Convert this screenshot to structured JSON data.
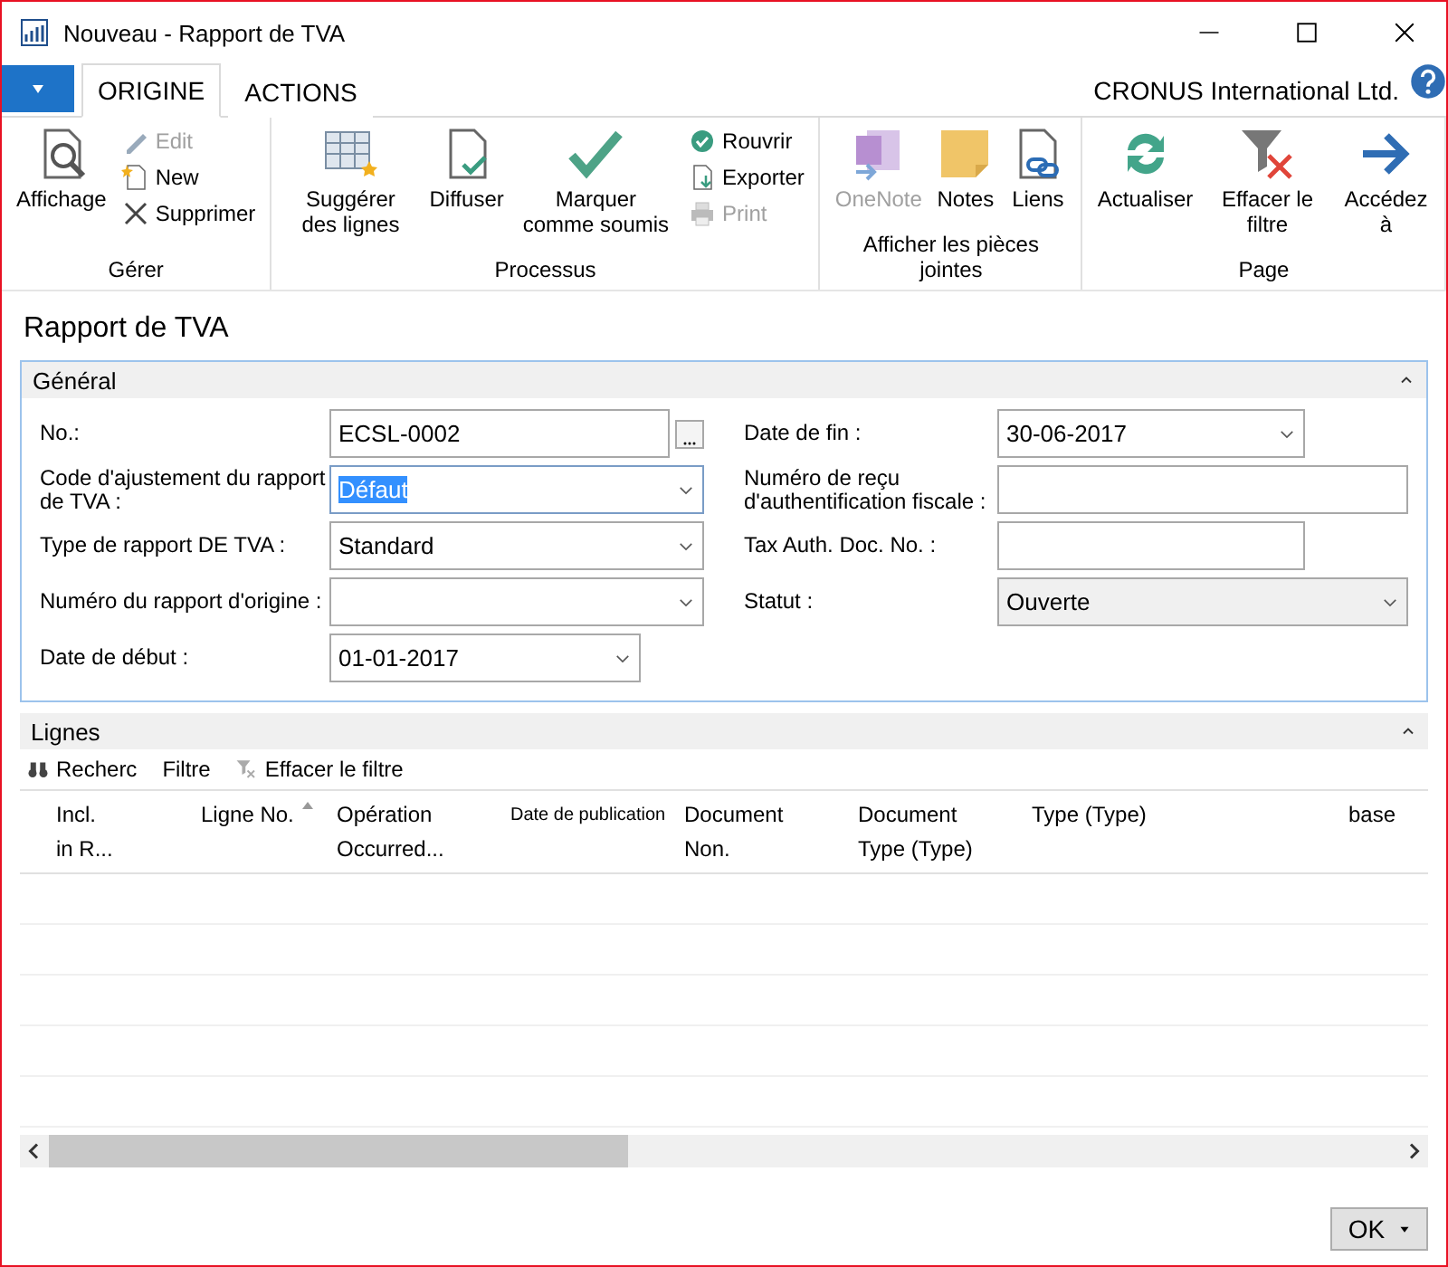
{
  "window": {
    "title": "Nouveau - Rapport de TVA"
  },
  "menu_tabs": [
    {
      "label": "ORIGINE",
      "selected": true
    },
    {
      "label": "ACTIONS",
      "selected": false
    }
  ],
  "company": "CRONUS International Ltd.",
  "ribbon": [
    {
      "label": "Gérer",
      "items": [
        {
          "kind": "large",
          "label": "Affichage",
          "disabled": false
        },
        {
          "kind": "small",
          "label": "Edit",
          "disabled": true
        },
        {
          "kind": "small",
          "label": "New",
          "disabled": false
        },
        {
          "kind": "small",
          "label": "Supprimer",
          "disabled": false
        }
      ]
    },
    {
      "label": "Processus",
      "items": [
        {
          "kind": "large",
          "label": "Suggérer des lignes",
          "disabled": false
        },
        {
          "kind": "large",
          "label": "Diffuser",
          "disabled": false
        },
        {
          "kind": "large",
          "label": "Marquer comme soumis",
          "disabled": false
        },
        {
          "kind": "small",
          "label": "Rouvrir",
          "disabled": false
        },
        {
          "kind": "small",
          "label": "Exporter",
          "disabled": false
        },
        {
          "kind": "small",
          "label": "Print",
          "disabled": true
        }
      ]
    },
    {
      "label": "Afficher les pièces jointes",
      "items": [
        {
          "kind": "large",
          "label": "OneNote",
          "disabled": true
        },
        {
          "kind": "large",
          "label": "Notes",
          "disabled": false
        },
        {
          "kind": "large",
          "label": "Liens",
          "disabled": false
        }
      ]
    },
    {
      "label": "Page",
      "items": [
        {
          "kind": "large",
          "label": "Actualiser",
          "disabled": false
        },
        {
          "kind": "large",
          "label": "Effacer le filtre",
          "disabled": false
        },
        {
          "kind": "large",
          "label": "Accédez à",
          "disabled": false
        }
      ]
    }
  ],
  "page_title": "Rapport de TVA",
  "general": {
    "title": "Général",
    "expanded": true,
    "left": [
      {
        "label": "No.:",
        "value": "ECSL-0002",
        "kind": "lookup",
        "highlighted": false
      },
      {
        "label": "Code d'ajustement du rapport de TVA :",
        "value": "Défaut",
        "kind": "dropdown",
        "highlighted": true
      },
      {
        "label": "Type de rapport DE TVA :",
        "value": "Standard",
        "kind": "dropdown",
        "highlighted": false
      },
      {
        "label": "Numéro du rapport d'origine :",
        "kind": "dropdown",
        "highlighted": false
      },
      {
        "label": "Date de début :",
        "value": "01-01-2017",
        "kind": "date",
        "highlighted": false
      }
    ],
    "right": [
      {
        "label": "Date de fin :",
        "value": "30-06-2017",
        "kind": "date",
        "highlighted": false
      },
      {
        "label": "Numéro de reçu d'authentification fiscale :",
        "kind": "text",
        "highlighted": false
      },
      {
        "label": "Tax Auth. Doc. No. :",
        "kind": "short",
        "highlighted": false
      },
      {
        "label": "Statut :",
        "value": "Ouverte",
        "kind": "option",
        "highlighted": false
      }
    ]
  },
  "lines": {
    "title": "Lignes",
    "expanded": true,
    "toolbar": [
      {
        "label": "Recherc",
        "kind": "search"
      },
      {
        "label": "Filtre",
        "kind": "plain"
      },
      {
        "label": "Effacer le filtre",
        "kind": "clear"
      }
    ],
    "columns": [
      {
        "label": "Incl.\nin R...",
        "sorted": false
      },
      {
        "label": "Ligne No.",
        "sorted": true
      },
      {
        "label": "Opération\nOccurred...",
        "sorted": false
      },
      {
        "label": "Date de publication",
        "sorted": false
      },
      {
        "label": "Document\nNon.",
        "sorted": false
      },
      {
        "label": "Document\nType (Type)",
        "sorted": false
      },
      {
        "label": "Type (Type)",
        "sorted": false
      },
      {
        "label": "base",
        "sorted": false
      }
    ]
  },
  "ok_button": "OK"
}
